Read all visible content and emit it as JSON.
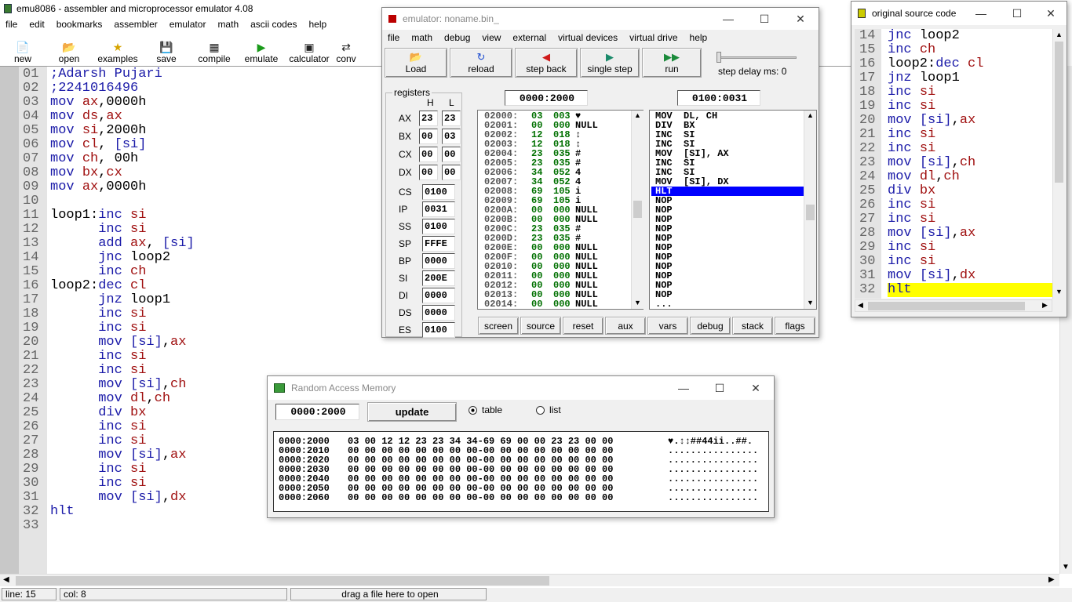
{
  "main": {
    "title": "emu8086 - assembler and microprocessor emulator 4.08",
    "menu": [
      "file",
      "edit",
      "bookmarks",
      "assembler",
      "emulator",
      "math",
      "ascii codes",
      "help"
    ],
    "toolbar": [
      "new",
      "open",
      "examples",
      "save",
      "compile",
      "emulate",
      "calculator",
      "conv"
    ],
    "lines": [
      [
        [
          "cm",
          ";Adarsh Pujari"
        ]
      ],
      [
        [
          "cm",
          ";2241016496"
        ]
      ],
      [
        [
          "kw",
          "mov "
        ],
        [
          "rg",
          "ax"
        ],
        [
          "lb",
          ",0000h"
        ]
      ],
      [
        [
          "kw",
          "mov "
        ],
        [
          "rg",
          "ds"
        ],
        [
          "lb",
          ","
        ],
        [
          "rg",
          "ax"
        ]
      ],
      [
        [
          "kw",
          "mov "
        ],
        [
          "rg",
          "si"
        ],
        [
          "lb",
          ",2000h"
        ]
      ],
      [
        [
          "kw",
          "mov "
        ],
        [
          "rg",
          "cl"
        ],
        [
          "lb",
          ", "
        ],
        [
          "br",
          "[si]"
        ]
      ],
      [
        [
          "kw",
          "mov "
        ],
        [
          "rg",
          "ch"
        ],
        [
          "lb",
          ", 00h"
        ]
      ],
      [
        [
          "kw",
          "mov "
        ],
        [
          "rg",
          "bx"
        ],
        [
          "lb",
          ","
        ],
        [
          "rg",
          "cx"
        ]
      ],
      [
        [
          "kw",
          "mov "
        ],
        [
          "rg",
          "ax"
        ],
        [
          "lb",
          ",0000h"
        ]
      ],
      [
        [
          "lb",
          ""
        ]
      ],
      [
        [
          "lb",
          "loop1:"
        ],
        [
          "kw",
          "inc "
        ],
        [
          "rg",
          "si"
        ]
      ],
      [
        [
          "lb",
          "      "
        ],
        [
          "kw",
          "inc "
        ],
        [
          "rg",
          "si"
        ]
      ],
      [
        [
          "lb",
          "      "
        ],
        [
          "kw",
          "add "
        ],
        [
          "rg",
          "ax"
        ],
        [
          "lb",
          ", "
        ],
        [
          "br",
          "[si]"
        ]
      ],
      [
        [
          "lb",
          "      "
        ],
        [
          "kw",
          "jnc "
        ],
        [
          "lb",
          "loop2"
        ]
      ],
      [
        [
          "lb",
          "      "
        ],
        [
          "kw",
          "inc "
        ],
        [
          "rg",
          "ch"
        ]
      ],
      [
        [
          "lb",
          "loop2:"
        ],
        [
          "kw",
          "dec "
        ],
        [
          "rg",
          "cl"
        ]
      ],
      [
        [
          "lb",
          "      "
        ],
        [
          "kw",
          "jnz "
        ],
        [
          "lb",
          "loop1"
        ]
      ],
      [
        [
          "lb",
          "      "
        ],
        [
          "kw",
          "inc "
        ],
        [
          "rg",
          "si"
        ]
      ],
      [
        [
          "lb",
          "      "
        ],
        [
          "kw",
          "inc "
        ],
        [
          "rg",
          "si"
        ]
      ],
      [
        [
          "lb",
          "      "
        ],
        [
          "kw",
          "mov "
        ],
        [
          "br",
          "[si]"
        ],
        [
          "lb",
          ","
        ],
        [
          "rg",
          "ax"
        ]
      ],
      [
        [
          "lb",
          "      "
        ],
        [
          "kw",
          "inc "
        ],
        [
          "rg",
          "si"
        ]
      ],
      [
        [
          "lb",
          "      "
        ],
        [
          "kw",
          "inc "
        ],
        [
          "rg",
          "si"
        ]
      ],
      [
        [
          "lb",
          "      "
        ],
        [
          "kw",
          "mov "
        ],
        [
          "br",
          "[si]"
        ],
        [
          "lb",
          ","
        ],
        [
          "rg",
          "ch"
        ]
      ],
      [
        [
          "lb",
          "      "
        ],
        [
          "kw",
          "mov "
        ],
        [
          "rg",
          "dl"
        ],
        [
          "lb",
          ","
        ],
        [
          "rg",
          "ch"
        ]
      ],
      [
        [
          "lb",
          "      "
        ],
        [
          "kw",
          "div "
        ],
        [
          "rg",
          "bx"
        ]
      ],
      [
        [
          "lb",
          "      "
        ],
        [
          "kw",
          "inc "
        ],
        [
          "rg",
          "si"
        ]
      ],
      [
        [
          "lb",
          "      "
        ],
        [
          "kw",
          "inc "
        ],
        [
          "rg",
          "si"
        ]
      ],
      [
        [
          "lb",
          "      "
        ],
        [
          "kw",
          "mov "
        ],
        [
          "br",
          "[si]"
        ],
        [
          "lb",
          ","
        ],
        [
          "rg",
          "ax"
        ]
      ],
      [
        [
          "lb",
          "      "
        ],
        [
          "kw",
          "inc "
        ],
        [
          "rg",
          "si"
        ]
      ],
      [
        [
          "lb",
          "      "
        ],
        [
          "kw",
          "inc "
        ],
        [
          "rg",
          "si"
        ]
      ],
      [
        [
          "lb",
          "      "
        ],
        [
          "kw",
          "mov "
        ],
        [
          "br",
          "[si]"
        ],
        [
          "lb",
          ","
        ],
        [
          "rg",
          "dx"
        ]
      ],
      [
        [
          "kw",
          "hlt"
        ]
      ],
      [
        [
          "lb",
          ""
        ]
      ]
    ],
    "status": {
      "line": "line: 15",
      "col": "col: 8",
      "hint": "drag a file here to open"
    }
  },
  "emulator": {
    "title": "emulator: noname.bin_",
    "menu": [
      "file",
      "math",
      "debug",
      "view",
      "external",
      "virtual devices",
      "virtual drive",
      "help"
    ],
    "buttons": [
      "Load",
      "reload",
      "step back",
      "single step",
      "run"
    ],
    "step_delay": "step delay ms: 0",
    "registers_label": "registers",
    "h": "H",
    "l": "L",
    "regs8": [
      [
        "AX",
        "23",
        "23"
      ],
      [
        "BX",
        "00",
        "03"
      ],
      [
        "CX",
        "00",
        "00"
      ],
      [
        "DX",
        "00",
        "00"
      ]
    ],
    "regs16": [
      [
        "CS",
        "0100"
      ],
      [
        "IP",
        "0031"
      ],
      [
        "SS",
        "0100"
      ],
      [
        "SP",
        "FFFE"
      ],
      [
        "BP",
        "0000"
      ],
      [
        "SI",
        "200E"
      ],
      [
        "DI",
        "0000"
      ],
      [
        "DS",
        "0000"
      ],
      [
        "ES",
        "0100"
      ]
    ],
    "addr_left": "0000:2000",
    "addr_right": "0100:0031",
    "mem": [
      [
        "02000:",
        "03",
        "003",
        "♥"
      ],
      [
        "02001:",
        "00",
        "000",
        "NULL"
      ],
      [
        "02002:",
        "12",
        "018",
        "↕"
      ],
      [
        "02003:",
        "12",
        "018",
        "↕"
      ],
      [
        "02004:",
        "23",
        "035",
        "#"
      ],
      [
        "02005:",
        "23",
        "035",
        "#"
      ],
      [
        "02006:",
        "34",
        "052",
        "4"
      ],
      [
        "02007:",
        "34",
        "052",
        "4"
      ],
      [
        "02008:",
        "69",
        "105",
        "i"
      ],
      [
        "02009:",
        "69",
        "105",
        "i"
      ],
      [
        "0200A:",
        "00",
        "000",
        "NULL"
      ],
      [
        "0200B:",
        "00",
        "000",
        "NULL"
      ],
      [
        "0200C:",
        "23",
        "035",
        "#"
      ],
      [
        "0200D:",
        "23",
        "035",
        "#"
      ],
      [
        "0200E:",
        "00",
        "000",
        "NULL"
      ],
      [
        "0200F:",
        "00",
        "000",
        "NULL"
      ],
      [
        "02010:",
        "00",
        "000",
        "NULL"
      ],
      [
        "02011:",
        "00",
        "000",
        "NULL"
      ],
      [
        "02012:",
        "00",
        "000",
        "NULL"
      ],
      [
        "02013:",
        "00",
        "000",
        "NULL"
      ],
      [
        "02014:",
        "00",
        "000",
        "NULL"
      ]
    ],
    "disasm": [
      "MOV  DL, CH",
      "DIV  BX",
      "INC  SI",
      "INC  SI",
      "MOV  [SI], AX",
      "INC  SI",
      "INC  SI",
      "MOV  [SI], DX",
      "HLT",
      "NOP",
      "NOP",
      "NOP",
      "NOP",
      "NOP",
      "NOP",
      "NOP",
      "NOP",
      "NOP",
      "NOP",
      "NOP",
      "..."
    ],
    "bottom": [
      "screen",
      "source",
      "reset",
      "aux",
      "vars",
      "debug",
      "stack",
      "flags"
    ]
  },
  "source": {
    "title": "original source code",
    "start": 14,
    "lines": [
      [
        [
          "kw",
          "jnc "
        ],
        [
          "lb",
          "loop2"
        ]
      ],
      [
        [
          "kw",
          "inc "
        ],
        [
          "rg",
          "ch"
        ]
      ],
      [
        [
          "lb",
          "loop2:"
        ],
        [
          "kw",
          "dec "
        ],
        [
          "rg",
          "cl"
        ]
      ],
      [
        [
          "kw",
          "jnz "
        ],
        [
          "lb",
          "loop1"
        ]
      ],
      [
        [
          "kw",
          "inc "
        ],
        [
          "rg",
          "si"
        ]
      ],
      [
        [
          "kw",
          "inc "
        ],
        [
          "rg",
          "si"
        ]
      ],
      [
        [
          "kw",
          "mov "
        ],
        [
          "br",
          "[si]"
        ],
        [
          "lb",
          ","
        ],
        [
          "rg",
          "ax"
        ]
      ],
      [
        [
          "kw",
          "inc "
        ],
        [
          "rg",
          "si"
        ]
      ],
      [
        [
          "kw",
          "inc "
        ],
        [
          "rg",
          "si"
        ]
      ],
      [
        [
          "kw",
          "mov "
        ],
        [
          "br",
          "[si]"
        ],
        [
          "lb",
          ","
        ],
        [
          "rg",
          "ch"
        ]
      ],
      [
        [
          "kw",
          "mov "
        ],
        [
          "rg",
          "dl"
        ],
        [
          "lb",
          ","
        ],
        [
          "rg",
          "ch"
        ]
      ],
      [
        [
          "kw",
          "div "
        ],
        [
          "rg",
          "bx"
        ]
      ],
      [
        [
          "kw",
          "inc "
        ],
        [
          "rg",
          "si"
        ]
      ],
      [
        [
          "kw",
          "inc "
        ],
        [
          "rg",
          "si"
        ]
      ],
      [
        [
          "kw",
          "mov "
        ],
        [
          "br",
          "[si]"
        ],
        [
          "lb",
          ","
        ],
        [
          "rg",
          "ax"
        ]
      ],
      [
        [
          "kw",
          "inc "
        ],
        [
          "rg",
          "si"
        ]
      ],
      [
        [
          "kw",
          "inc "
        ],
        [
          "rg",
          "si"
        ]
      ],
      [
        [
          "kw",
          "mov "
        ],
        [
          "br",
          "[si]"
        ],
        [
          "lb",
          ","
        ],
        [
          "rg",
          "dx"
        ]
      ],
      [
        [
          "kw",
          "hlt"
        ]
      ]
    ]
  },
  "ram": {
    "title": "Random Access Memory",
    "address": "0000:2000",
    "update": "update",
    "table": "table",
    "list": "list",
    "rows": [
      [
        "0000:2000",
        "03 00 12 12 23 23 34 34-69 69 00 00 23 23 00 00",
        "♥.↕↕##44ii..##."
      ],
      [
        "0000:2010",
        "00 00 00 00 00 00 00 00-00 00 00 00 00 00 00 00",
        "................"
      ],
      [
        "0000:2020",
        "00 00 00 00 00 00 00 00-00 00 00 00 00 00 00 00",
        "................"
      ],
      [
        "0000:2030",
        "00 00 00 00 00 00 00 00-00 00 00 00 00 00 00 00",
        "................"
      ],
      [
        "0000:2040",
        "00 00 00 00 00 00 00 00-00 00 00 00 00 00 00 00",
        "................"
      ],
      [
        "0000:2050",
        "00 00 00 00 00 00 00 00-00 00 00 00 00 00 00 00",
        "................"
      ],
      [
        "0000:2060",
        "00 00 00 00 00 00 00 00-00 00 00 00 00 00 00 00",
        "................"
      ]
    ]
  },
  "colors": {
    "keyword": "#1a1aa8",
    "register": "#a01010",
    "highlight_blue": "#0000ff",
    "highlight_yellow": "#ffff00",
    "green": "#007000"
  }
}
